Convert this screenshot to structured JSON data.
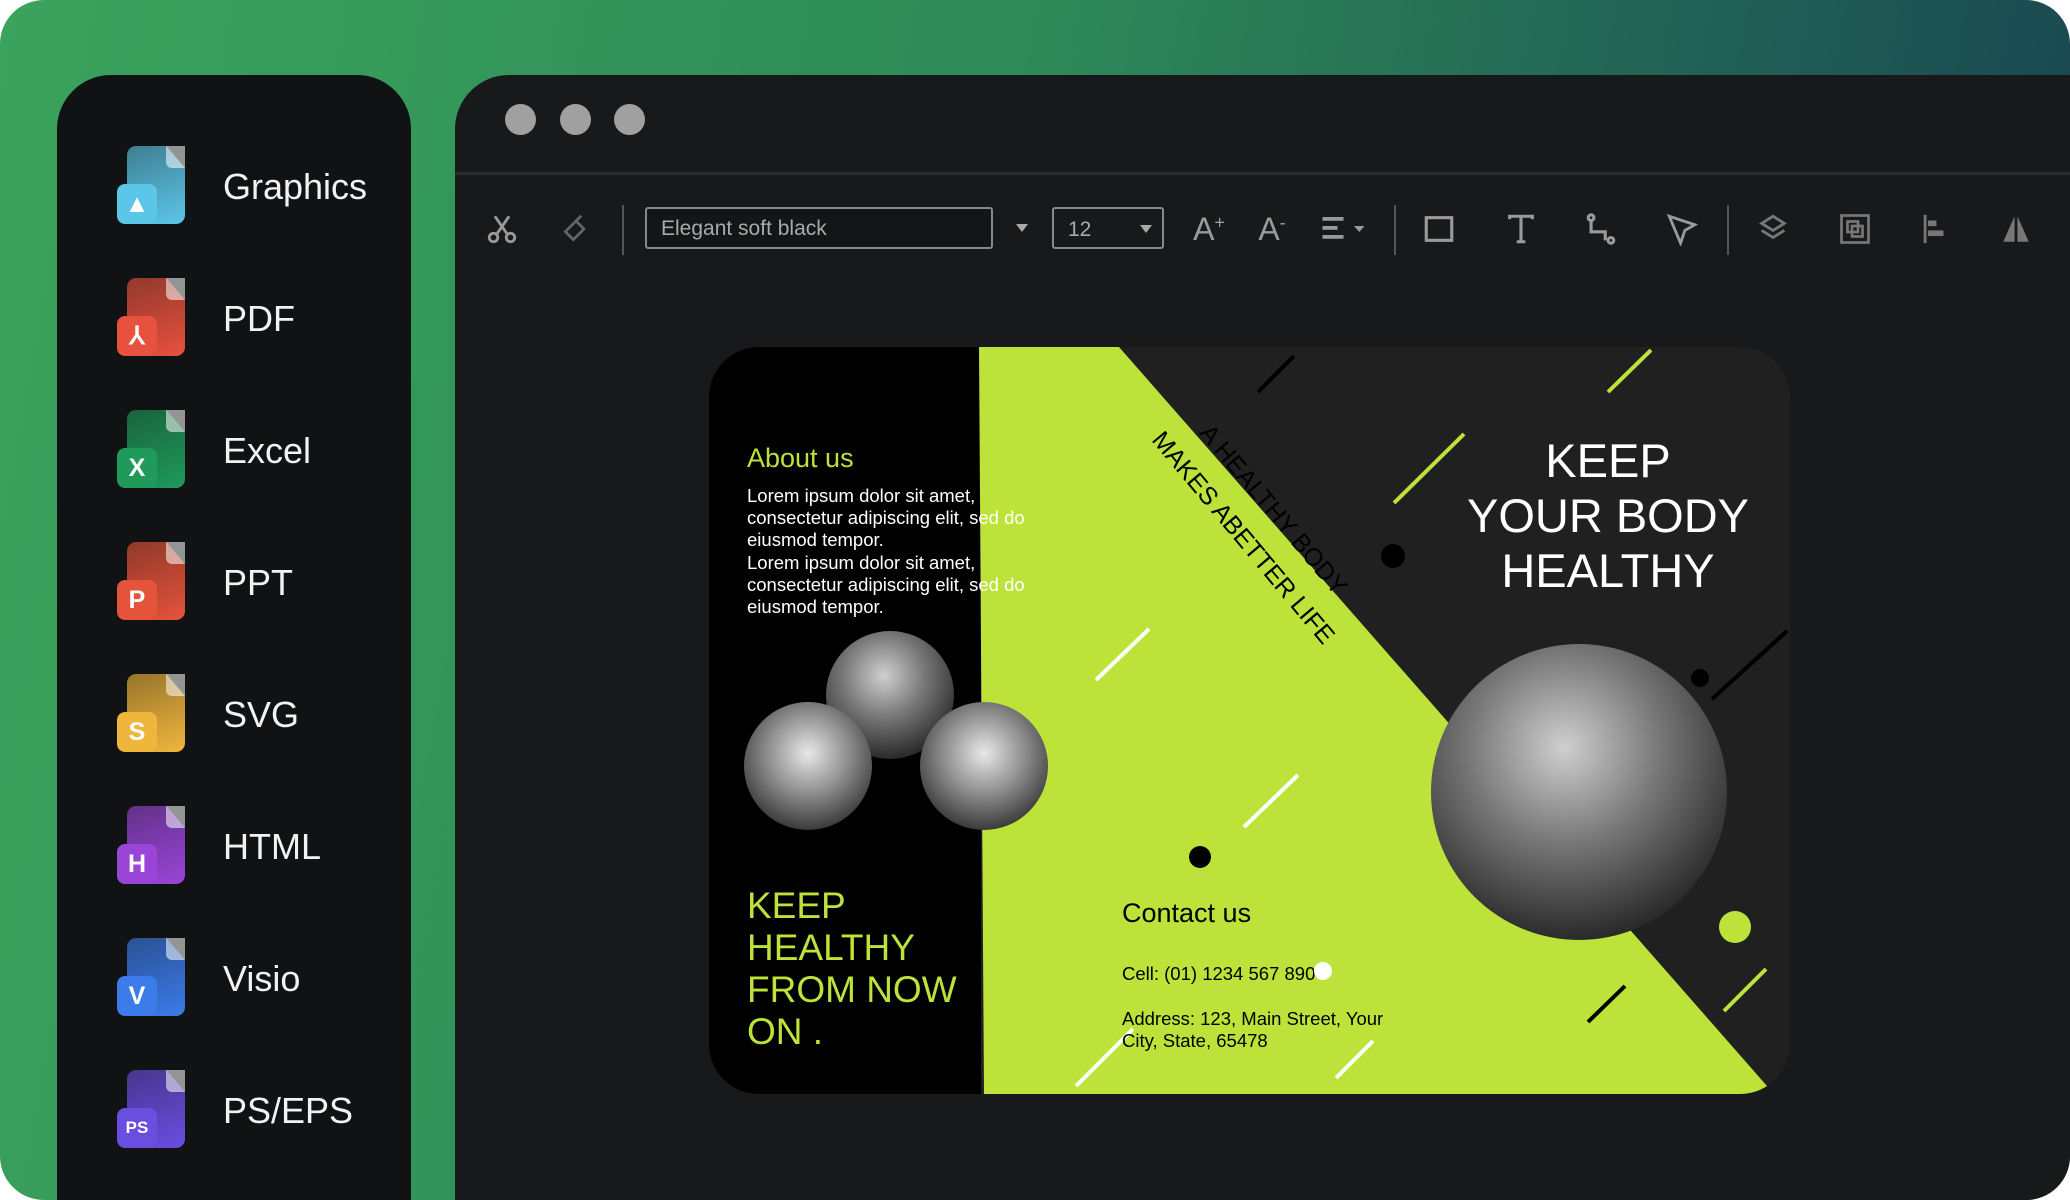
{
  "sidebar": {
    "items": [
      {
        "label": "Graphics",
        "icon": "graphics-file-icon",
        "color": "#5cc6e8",
        "badge": ""
      },
      {
        "label": "PDF",
        "icon": "pdf-file-icon",
        "color": "#e8513e",
        "badge": ""
      },
      {
        "label": "Excel",
        "icon": "excel-file-icon",
        "color": "#1f9a5a",
        "badge": "X"
      },
      {
        "label": "PPT",
        "icon": "ppt-file-icon",
        "color": "#e5533a",
        "badge": "P"
      },
      {
        "label": "SVG",
        "icon": "svg-file-icon",
        "color": "#f0b63c",
        "badge": "S"
      },
      {
        "label": "HTML",
        "icon": "html-file-icon",
        "color": "#9a45d8",
        "badge": "H"
      },
      {
        "label": "Visio",
        "icon": "visio-file-icon",
        "color": "#3b7bea",
        "badge": "V"
      },
      {
        "label": "PS/EPS",
        "icon": "ps-eps-file-icon",
        "color": "#6a4ee0",
        "badge": "PS"
      }
    ]
  },
  "toolbar": {
    "font_value": "Elegant soft black",
    "size_value": "12"
  },
  "design": {
    "accent": "#bde33a",
    "about_title": "About us",
    "about_lines": [
      "Lorem ipsum dolor sit amet,",
      "consectetur adipiscing elit, sed do",
      "eiusmod tempor.",
      "Lorem ipsum dolor sit amet,",
      "consectetur adipiscing elit, sed do",
      "eiusmod tempor."
    ],
    "slogan_lines": [
      "KEEP",
      "HEALTHY",
      "FROM NOW",
      "ON ."
    ],
    "diagonal_line1": "A HEALTHY BODY",
    "diagonal_line2": "MAKES ABETTER LIFE",
    "headline_lines": [
      "KEEP",
      "YOUR BODY",
      "HEALTHY"
    ],
    "contact_title": "Contact us",
    "cell": "Cell: (01) 1234 567 890",
    "address_line1": "Address: 123, Main Street, Your",
    "address_line2": "City, State, 65478"
  }
}
